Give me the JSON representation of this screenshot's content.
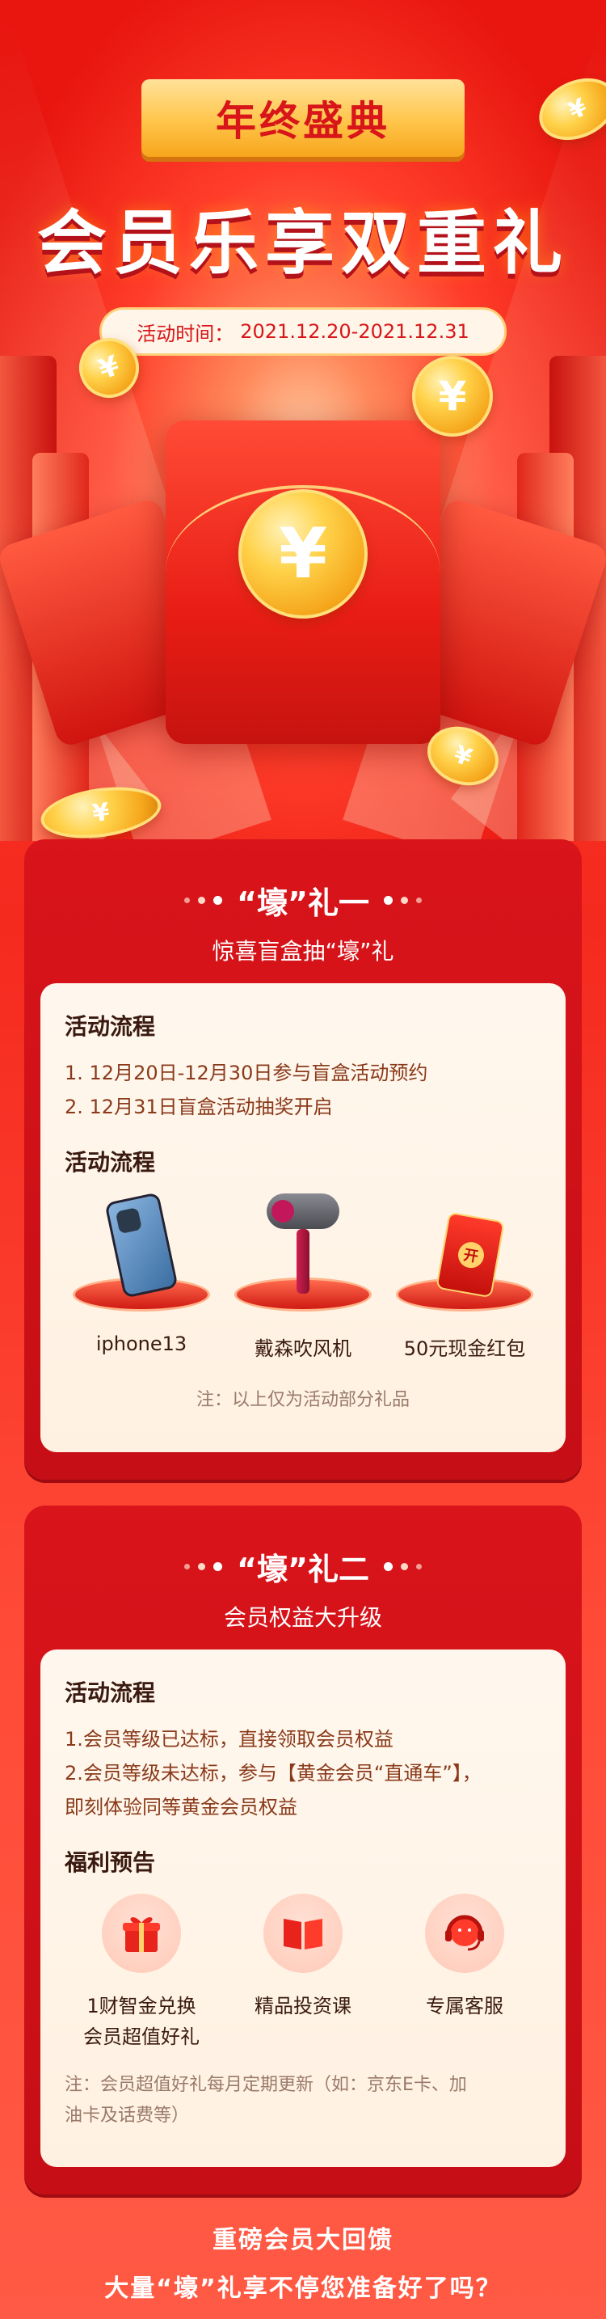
{
  "hero": {
    "banner": "年终盛典",
    "title": "会员乐享双重礼",
    "date_label": "活动时间：",
    "date_value": "2021.12.20-2021.12.31",
    "currency_symbol": "¥"
  },
  "gift1": {
    "title": "“壕”礼一",
    "subtitle": "惊喜盲盒抽“壕”礼",
    "flow_title": "活动流程",
    "steps": [
      "1. 12月20日-12月30日参与盲盒活动预约",
      "2. 12月31日盲盒活动抽奖开启"
    ],
    "prizes_title": "活动流程",
    "prizes": [
      {
        "name": "iphone13",
        "icon": "phone-icon"
      },
      {
        "name": "戴森吹风机",
        "icon": "hair-dryer-icon"
      },
      {
        "name": "50元现金红包",
        "icon": "red-packet-icon"
      }
    ],
    "packet_seal": "开",
    "note": "注：以上仅为活动部分礼品"
  },
  "gift2": {
    "title": "“壕”礼二",
    "subtitle": "会员权益大升级",
    "flow_title": "活动流程",
    "steps": [
      "1.会员等级已达标，直接领取会员权益",
      "2.会员等级未达标，参与【黄金会员“直通车”】，",
      "即刻体验同等黄金会员权益"
    ],
    "benefits_title": "福利预告",
    "benefits": [
      {
        "line1": "1财智金兑换",
        "line2": "会员超值好礼",
        "icon": "gift-box-icon"
      },
      {
        "line1": "精品投资课",
        "line2": "",
        "icon": "book-icon"
      },
      {
        "line1": "专属客服",
        "line2": "",
        "icon": "headset-icon"
      }
    ],
    "note_line1": "注：会员超值好礼每月定期更新（如：京东E卡、加",
    "note_line2": "油卡及话费等）"
  },
  "footer": {
    "line1": "重磅会员大回馈",
    "line2": "大量“壕”礼享不停您准备好了吗？"
  },
  "colors": {
    "brand_red": "#d9141a",
    "gold": "#ffc54a",
    "card_bg": "#fff7ee"
  }
}
